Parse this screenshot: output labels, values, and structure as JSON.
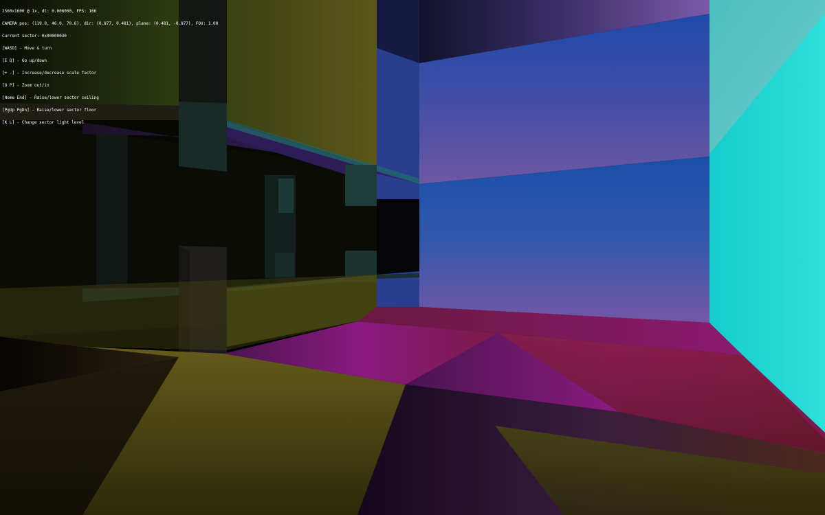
{
  "hud": {
    "lines": [
      "2560x1600 @ 1x, dt: 0.006000, FPS: 166",
      "CAMERA pos: (119.0, 46.0, 70.6), dir: (0.877, 0.481), plane: (0.481, -0.877), FOV: 1.00",
      "Current sector: 0x00000030",
      "[WASD] - Move & turn",
      "[E Q] - Go up/down",
      "[+ -] - Increase/decrease scale factor",
      "[O P] - Zoom out/in",
      "[Home End] - Raise/lower sector ceiling",
      "[PgUp PgDn] - Raise/lower sector floor",
      "[K L] - Change sector light level"
    ]
  },
  "colors": {
    "background": "#000000",
    "hud_text": "#ffffff",
    "blue_wall": "#2b57b0",
    "purple_band": "#6a55a0",
    "cyan_wall": "#18d2d2",
    "olive_floor": "#5a5a12",
    "magenta_floor": "#861a76",
    "red_floor": "#801c2c"
  }
}
